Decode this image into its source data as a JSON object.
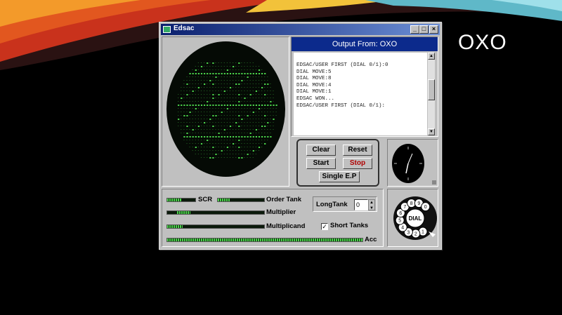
{
  "slide": {
    "title": "OXO"
  },
  "window": {
    "title": "Edsac",
    "controls": {
      "minimize": "_",
      "maximize": "□",
      "close": "×"
    }
  },
  "output": {
    "header": "Output From: OXO",
    "lines": [
      "EDSAC/USER FIRST (DIAL 0/1):0",
      "DIAL MOVE:5",
      "DIAL MOVE:8",
      "DIAL MOVE:4",
      "DIAL MOVE:1",
      "EDSAC WON...",
      "",
      "EDSAC/USER FIRST (DIAL 0/1):"
    ]
  },
  "controls": {
    "clear": "Clear",
    "reset": "Reset",
    "start": "Start",
    "stop": "Stop",
    "single_ep": "Single E.P",
    "stop_color": "#b00000"
  },
  "registers": {
    "scr": "SCR",
    "order_tank": "Order Tank",
    "multiplier": "Multiplier",
    "multiplicand": "Multiplicand",
    "acc": "Acc",
    "long_tank_label": "LongTank",
    "long_tank_value": "0",
    "short_tanks_label": "Short Tanks",
    "short_tanks_checked": true
  },
  "dial": {
    "label": "DIAL",
    "digits": [
      "1",
      "2",
      "3",
      "4",
      "5",
      "6",
      "7",
      "8",
      "9",
      "0"
    ]
  },
  "colors": {
    "accent_green": "#4bd44b",
    "title_blue": "#0c2a8c"
  }
}
